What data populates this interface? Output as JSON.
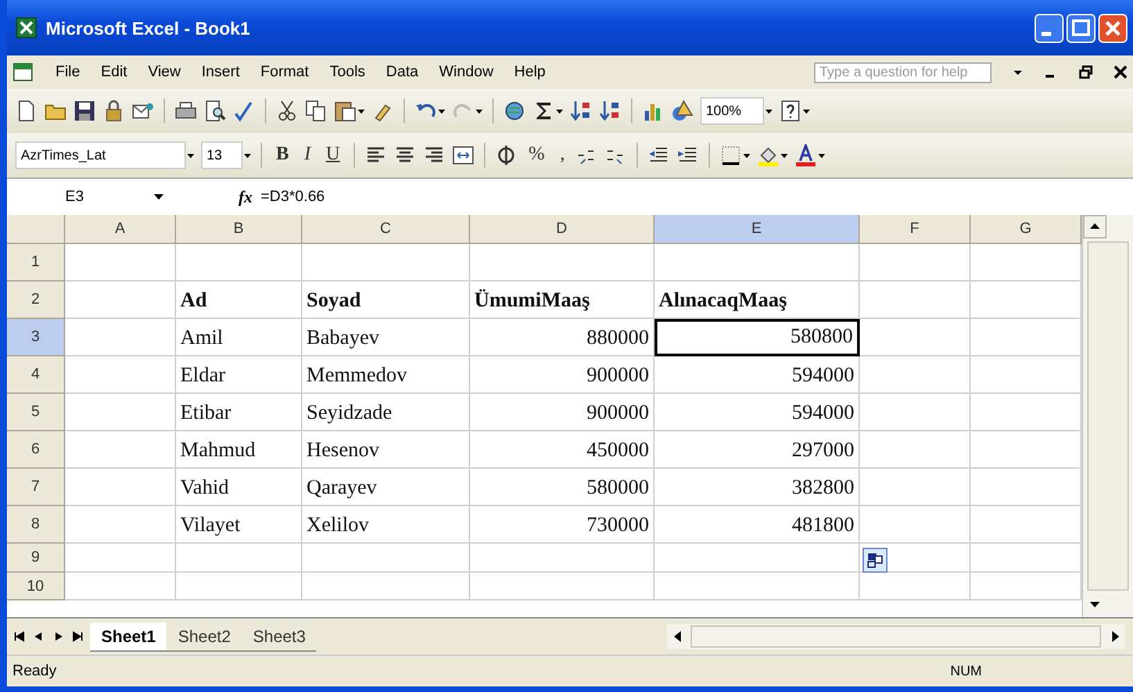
{
  "window": {
    "title": "Microsoft Excel - Book1"
  },
  "menu": [
    "File",
    "Edit",
    "View",
    "Insert",
    "Format",
    "Tools",
    "Data",
    "Window",
    "Help"
  ],
  "help_box": {
    "placeholder": "Type a question for help"
  },
  "standard_toolbar": {
    "zoom": "100%"
  },
  "format_toolbar": {
    "font": "AzrTimes_Lat",
    "size": "13",
    "buttons": [
      {
        "label": "B",
        "kind": "bold"
      },
      {
        "label": "I",
        "kind": "italic"
      },
      {
        "label": "U",
        "kind": "underline"
      }
    ],
    "number_buttons": [
      "%",
      ","
    ]
  },
  "formula_bar": {
    "name_box": "E3",
    "function_label": "fx",
    "formula": "=D3*0.66"
  },
  "columns": [
    {
      "label": "A",
      "selected": false
    },
    {
      "label": "B",
      "selected": false
    },
    {
      "label": "C",
      "selected": false
    },
    {
      "label": "D",
      "selected": false
    },
    {
      "label": "E",
      "selected": true
    },
    {
      "label": "F",
      "selected": false
    },
    {
      "label": "G",
      "selected": false
    }
  ],
  "rows": [
    {
      "number": "1",
      "selected": false,
      "cells": [
        null,
        null,
        null,
        null,
        null,
        null,
        null
      ]
    },
    {
      "number": "2",
      "selected": false,
      "cells": [
        null,
        {
          "text": "Ad",
          "kind": "heading"
        },
        {
          "text": "Soyad",
          "kind": "heading"
        },
        {
          "text": "ÜmumiMaaş",
          "kind": "heading"
        },
        {
          "text": "AlınacaqMaaş",
          "kind": "heading"
        },
        null,
        null
      ]
    },
    {
      "number": "3",
      "selected": true,
      "cells": [
        null,
        {
          "text": "Amil",
          "kind": "text"
        },
        {
          "text": "Babayev",
          "kind": "text"
        },
        {
          "text": "880000",
          "kind": "number"
        },
        {
          "text": "580800",
          "kind": "number",
          "active": true
        },
        null,
        null
      ]
    },
    {
      "number": "4",
      "selected": false,
      "cells": [
        null,
        {
          "text": "Eldar",
          "kind": "text"
        },
        {
          "text": "Memmedov",
          "kind": "text"
        },
        {
          "text": "900000",
          "kind": "number"
        },
        {
          "text": "594000",
          "kind": "number"
        },
        null,
        null
      ]
    },
    {
      "number": "5",
      "selected": false,
      "cells": [
        null,
        {
          "text": "Etibar",
          "kind": "text"
        },
        {
          "text": "Seyidzade",
          "kind": "text"
        },
        {
          "text": "900000",
          "kind": "number"
        },
        {
          "text": "594000",
          "kind": "number"
        },
        null,
        null
      ]
    },
    {
      "number": "6",
      "selected": false,
      "cells": [
        null,
        {
          "text": "Mahmud",
          "kind": "text"
        },
        {
          "text": "Hesenov",
          "kind": "text"
        },
        {
          "text": "450000",
          "kind": "number"
        },
        {
          "text": "297000",
          "kind": "number"
        },
        null,
        null
      ]
    },
    {
      "number": "7",
      "selected": false,
      "cells": [
        null,
        {
          "text": "Vahid",
          "kind": "text"
        },
        {
          "text": "Qarayev",
          "kind": "text"
        },
        {
          "text": "580000",
          "kind": "number"
        },
        {
          "text": "382800",
          "kind": "number"
        },
        null,
        null
      ]
    },
    {
      "number": "8",
      "selected": false,
      "cells": [
        null,
        {
          "text": "Vilayet",
          "kind": "text"
        },
        {
          "text": "Xelilov",
          "kind": "text"
        },
        {
          "text": "730000",
          "kind": "number"
        },
        {
          "text": "481800",
          "kind": "number"
        },
        null,
        null
      ]
    },
    {
      "number": "9",
      "selected": false,
      "cells": [
        null,
        null,
        null,
        null,
        null,
        null,
        null
      ]
    },
    {
      "number": "10",
      "selected": false,
      "cells": [
        null,
        null,
        null,
        null,
        null,
        null,
        null
      ]
    }
  ],
  "sheets": [
    {
      "label": "Sheet1",
      "selected": true
    },
    {
      "label": "Sheet2",
      "selected": false
    },
    {
      "label": "Sheet3",
      "selected": false
    }
  ],
  "status_bar": {
    "mode": "Ready",
    "indicator": "NUM"
  }
}
